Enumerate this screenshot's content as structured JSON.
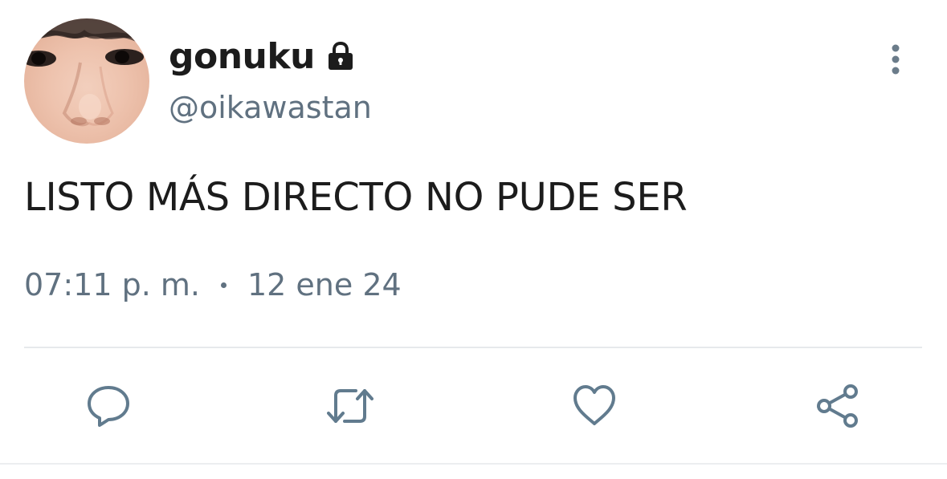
{
  "user": {
    "display_name": "gonuku",
    "handle": "@oikawastan",
    "protected_icon": "lock-icon",
    "avatar": "avatar-photo"
  },
  "tweet": {
    "text": "LISTO MÁS DIRECTO NO PUDE SER",
    "time": "07:11 p. m.",
    "date": "12 ene 24"
  },
  "actions": [
    {
      "name": "reply",
      "icon": "comment-icon"
    },
    {
      "name": "retweet",
      "icon": "retweet-icon"
    },
    {
      "name": "like",
      "icon": "heart-icon"
    },
    {
      "name": "share",
      "icon": "share-icon"
    }
  ],
  "colors": {
    "text_primary": "#1c1c1c",
    "text_secondary": "#607180",
    "icon": "#617b8e",
    "divider": "#e6e9ec"
  }
}
